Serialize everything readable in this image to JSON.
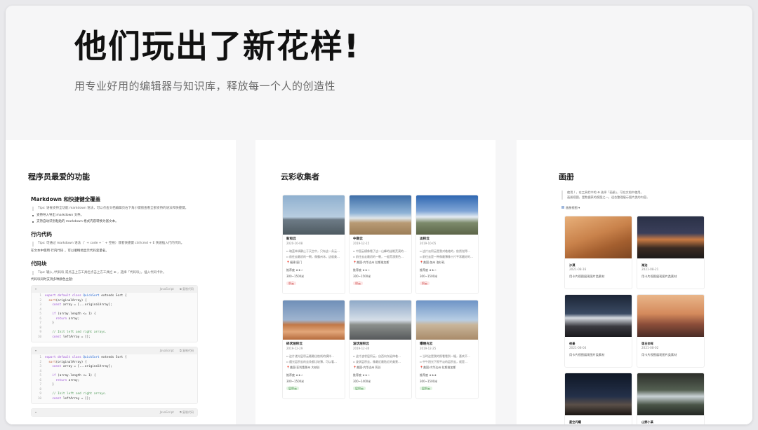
{
  "hero": {
    "title": "他们玩出了新花样!",
    "subtitle": "用专业好用的编辑器与知识库，释放每一个人的创造性"
  },
  "panel_dev": {
    "title": "程序员最爱的功能",
    "sec_markdown": {
      "heading": "Markdown 和快捷键全覆盖",
      "tip": "Tips: 语雀支持全功能 markdown 语法，可以点击文档编辑页右下角小键盘查看全部支持的语法和快捷键。",
      "bullet1": "支持导入导出 markdown 文件。",
      "bullet2": "支持自动识别粘贴的 markdown 格式内容转换为富文本。"
    },
    "sec_inline": {
      "heading": "行内代码",
      "tip": "Tips: 可通过 markdown 语法（` + code + ` + 空格）或者快捷键 ctrl/cmd + E 快速插入行内代码。",
      "text": "在文本中使用 行内代码 ，可以顺畅地显示代码变量名。"
    },
    "sec_block": {
      "heading": "代码块",
      "tip": "Tips: 输入 /代码块 或点击上方工具栏点击上方工具栏 ⊕ ，选择「代码块」，插入代码卡片。",
      "text": "代码块同时支持多种颜色主题：",
      "lang": "JavaScript",
      "copy": "复制代码",
      "lines": [
        {
          "n": "1",
          "kw": "export default class",
          "cls": " QuickSort ",
          "pl": "extends Sort {"
        },
        {
          "n": "2",
          "kw": "  ",
          "cls": "",
          "fn": "sort",
          "pl": "(originalArray) {"
        },
        {
          "n": "3",
          "kw": "    const",
          "cls": "",
          "pl": " array = [...originalArray];"
        },
        {
          "n": "4",
          "kw": "",
          "cls": "",
          "pl": ""
        },
        {
          "n": "5",
          "kw": "    if",
          "cls": "",
          "pl": " (array.length <= 1) {"
        },
        {
          "n": "6",
          "kw": "      return",
          "cls": "",
          "pl": " array;"
        },
        {
          "n": "7",
          "kw": "",
          "cls": "",
          "pl": "    }"
        },
        {
          "n": "8",
          "kw": "",
          "cls": "",
          "pl": ""
        },
        {
          "n": "9",
          "cm": "    // Init left and right arrays."
        },
        {
          "n": "10",
          "kw": "    const",
          "cls": "",
          "pl": " leftArray = [];"
        }
      ]
    }
  },
  "panel_cloud": {
    "title": "云彩收集者",
    "cards": [
      {
        "name": "新和云",
        "date": "2020-10-08",
        "desc": "暗蓝单调静止于天空中，只有这一朵云…",
        "desc2": "前往云最初的一朝，像霸州冰，这般美…",
        "loc": "福建·厦门",
        "rate": "推荐度  ★★☆",
        "price": "300~1500米",
        "tag": "积云",
        "tag_color": "red"
      },
      {
        "name": "中期云",
        "date": "2019-12-15",
        "desc": "中国云横像看了这一山峰的迷眼荒漠的…",
        "desc2": "前往云走最初的一朝，一般荒漠景色…",
        "loc": "美国·内华达州 拉斯维加斯",
        "rate": "推荐度  ★★☆",
        "price": "300~1500米",
        "tag": "积云",
        "tag_color": "red"
      },
      {
        "name": "淡积云",
        "date": "2019-10-05",
        "desc": "这片淡积云是我对着她的，依然觉得…",
        "desc2": "前往云是一种像最薄像十片平常最好的…",
        "loc": "美国·加州 洛杉矶",
        "rate": "推荐度  ★★☆",
        "price": "300~1500米",
        "tag": "积云",
        "tag_color": "red"
      },
      {
        "name": "碎状层积云",
        "date": "2019-12-29",
        "desc": "这片递光层积云最最佳航线的模样…",
        "desc2": "遇光层积云的云朵都比较薄，可以看…",
        "loc": "美国·亚利桑那州 大峡谷",
        "rate": "推荐度  ★★☆",
        "price": "300~1500米",
        "tag": "层积云",
        "tag_color": "green"
      },
      {
        "name": "波状层积云",
        "date": "2019-12-30",
        "desc": "这片波状层积云，自西向东延伸着…",
        "desc2": "波状层积云，像最近最贴近的美景…",
        "loc": "美国·内华达州 死谷",
        "rate": "推荐度  ★★☆",
        "price": "300~1400米",
        "tag": "层积云",
        "tag_color": "green"
      },
      {
        "name": "曝晒光云",
        "date": "2019-12-25",
        "desc": "当时这是我的照看看到一幅，喜欢不…",
        "desc2": "中午阳光下照平淡的层积云，就是…",
        "loc": "美国·内华达州 拉斯维加斯",
        "rate": "推荐度  ★★★",
        "price": "300~1500米",
        "tag": "层积云",
        "tag_color": "green"
      }
    ]
  },
  "panel_album": {
    "title": "画册",
    "note1": "使用 / ，在工具栏中的 ⊕ 选择「画册」，可在文档中使用。",
    "note2": "画册视图，是数据表的视图之一。适合整理展示图片类的内容。",
    "sort": "画册视图 ▾",
    "items": [
      {
        "name": "沙漠",
        "date": "2021-08-16",
        "desc": "用卡片视图展现图片类素材"
      },
      {
        "name": "湖泊",
        "date": "2021-08-21",
        "desc": "用卡片视图展现图片类素材"
      },
      {
        "name": "夜景",
        "date": "2021-08-04",
        "desc": "用卡片视图展现图片类素材"
      },
      {
        "name": "落日余晖",
        "date": "2021-08-02",
        "desc": "用卡片视图展现图片类素材"
      },
      {
        "name": "星空闪耀",
        "date": "2021-08-04",
        "desc": ""
      },
      {
        "name": "山野小溪",
        "date": "2021-08-09",
        "desc": ""
      }
    ]
  }
}
